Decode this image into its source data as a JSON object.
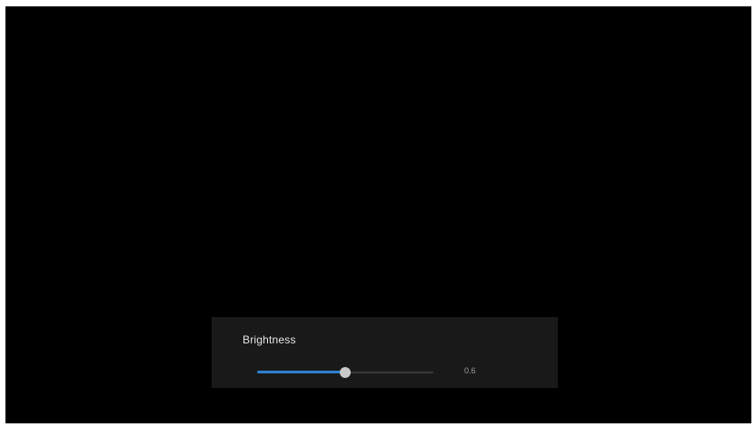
{
  "brightness_panel": {
    "label": "Brightness",
    "value_text": "0.6",
    "level": 0.5,
    "colors": {
      "fill": "#2f7fd0",
      "track": "#3a3a3a",
      "thumb": "#c9c9c9",
      "panel": "#191919",
      "background": "#000000"
    }
  }
}
